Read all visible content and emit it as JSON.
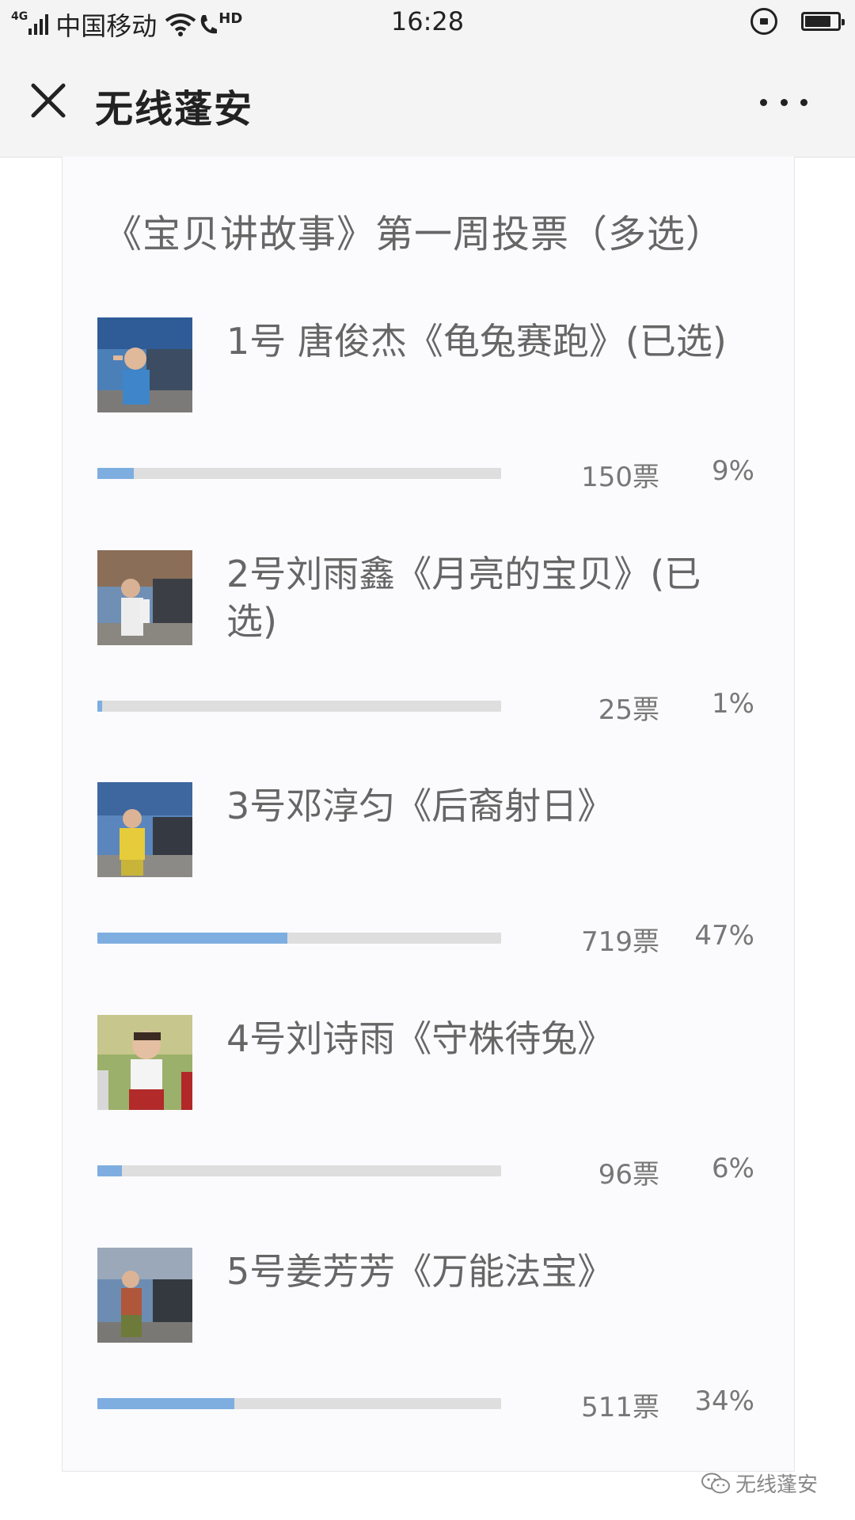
{
  "status_bar": {
    "network": "4G",
    "carrier": "中国移动",
    "hd": "HD",
    "time": "16:28",
    "battery_level": 0.8
  },
  "nav": {
    "title": "无线蓬安",
    "close_icon": "close-icon",
    "more_icon": "more-icon"
  },
  "poll": {
    "title": "《宝贝讲故事》第一周投票（多选）",
    "accent_color": "#7eaee0",
    "track_color": "#dedede",
    "options": [
      {
        "label": "1号 唐俊杰《龟兔赛跑》(已选)",
        "votes": "150票",
        "percent": "9%",
        "share": 0.09
      },
      {
        "label": "2号刘雨鑫《月亮的宝贝》(已选)",
        "votes": "25票",
        "percent": "1%",
        "share": 0.01
      },
      {
        "label": "3号邓淳匀《后裔射日》",
        "votes": "719票",
        "percent": "47%",
        "share": 0.47
      },
      {
        "label": "4号刘诗雨《守株待兔》",
        "votes": "96票",
        "percent": "6%",
        "share": 0.06
      },
      {
        "label": "5号姜芳芳《万能法宝》",
        "votes": "511票",
        "percent": "34%",
        "share": 0.34
      }
    ]
  },
  "watermark": {
    "text": "无线蓬安",
    "icon": "wechat-icon"
  }
}
